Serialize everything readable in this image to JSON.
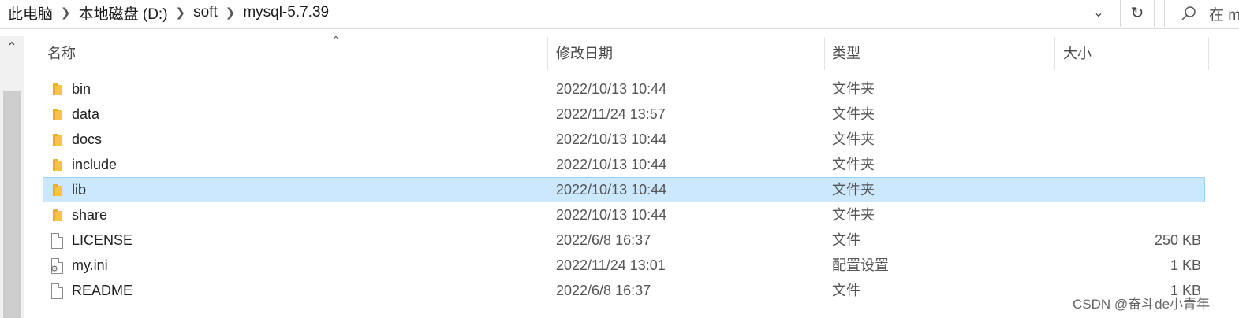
{
  "breadcrumb": [
    "此电脑",
    "本地磁盘 (D:)",
    "soft",
    "mysql-5.7.39"
  ],
  "search": {
    "placeholder": "在 m"
  },
  "columns": {
    "name": "名称",
    "date": "修改日期",
    "type": "类型",
    "size": "大小"
  },
  "files": [
    {
      "name": "bin",
      "date": "2022/10/13 10:44",
      "type": "文件夹",
      "size": "",
      "icon": "folder-icon"
    },
    {
      "name": "data",
      "date": "2022/11/24 13:57",
      "type": "文件夹",
      "size": "",
      "icon": "folder-icon"
    },
    {
      "name": "docs",
      "date": "2022/10/13 10:44",
      "type": "文件夹",
      "size": "",
      "icon": "folder-icon"
    },
    {
      "name": "include",
      "date": "2022/10/13 10:44",
      "type": "文件夹",
      "size": "",
      "icon": "folder-icon"
    },
    {
      "name": "lib",
      "date": "2022/10/13 10:44",
      "type": "文件夹",
      "size": "",
      "icon": "folder-icon",
      "selected": true
    },
    {
      "name": "share",
      "date": "2022/10/13 10:44",
      "type": "文件夹",
      "size": "",
      "icon": "folder-icon"
    },
    {
      "name": "LICENSE",
      "date": "2022/6/8 16:37",
      "type": "文件",
      "size": "250 KB",
      "icon": "file-icon"
    },
    {
      "name": "my.ini",
      "date": "2022/11/24 13:01",
      "type": "配置设置",
      "size": "1 KB",
      "icon": "settings-file-icon"
    },
    {
      "name": "README",
      "date": "2022/6/8 16:37",
      "type": "文件",
      "size": "1 KB",
      "icon": "file-icon"
    }
  ],
  "watermark": "CSDN @奋斗de小青年",
  "colors": {
    "selection_bg": "#cce8ff",
    "selection_border": "#99d1ff",
    "folder": "#f6c344"
  }
}
